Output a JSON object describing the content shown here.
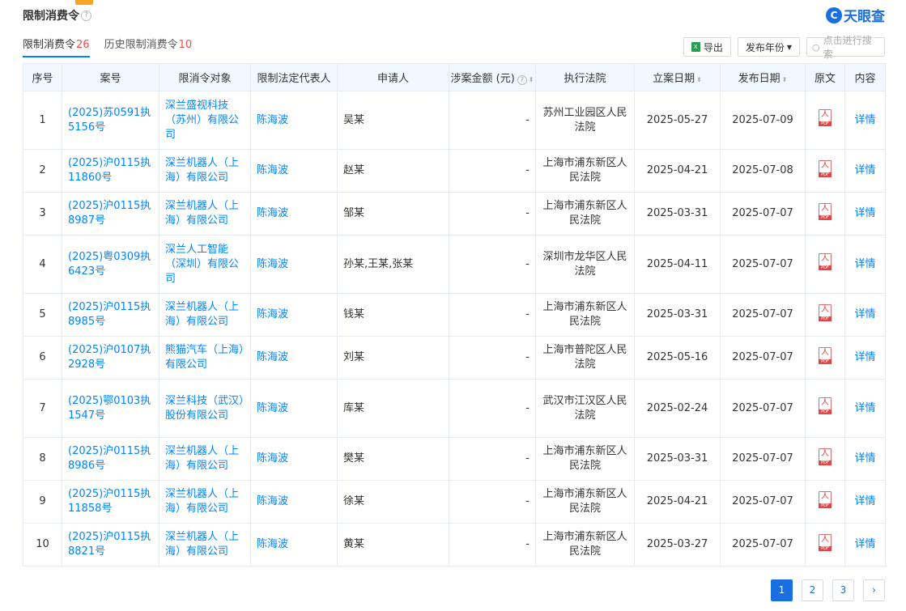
{
  "header": {
    "title": "限制消费令",
    "brand": "天眼查"
  },
  "tabs": [
    {
      "label": "限制消费令",
      "count": "26"
    },
    {
      "label": "历史限制消费令",
      "count": "10"
    }
  ],
  "toolbar": {
    "export_label": "导出",
    "year_label": "发布年份",
    "search_placeholder": "点击进行搜索"
  },
  "table": {
    "headers": [
      "序号",
      "案号",
      "限消令对象",
      "限制法定代表人",
      "申请人",
      "涉案金额 (元)",
      "执行法院",
      "立案日期",
      "发布日期",
      "原文",
      "内容"
    ],
    "rows": [
      {
        "no": "1",
        "case": "(2025)苏0591执5156号",
        "target": "深兰盛视科技（苏州）有限公司",
        "rep": "陈海波",
        "applicant": "吴某",
        "amount": "-",
        "court": "苏州工业园区人民法院",
        "filed": "2025-05-27",
        "published": "2025-07-09",
        "detail": "详情"
      },
      {
        "no": "2",
        "case": "(2025)沪0115执11860号",
        "target": "深兰机器人（上海）有限公司",
        "rep": "陈海波",
        "applicant": "赵某",
        "amount": "-",
        "court": "上海市浦东新区人民法院",
        "filed": "2025-04-21",
        "published": "2025-07-08",
        "detail": "详情"
      },
      {
        "no": "3",
        "case": "(2025)沪0115执8987号",
        "target": "深兰机器人（上海）有限公司",
        "rep": "陈海波",
        "applicant": "邹某",
        "amount": "-",
        "court": "上海市浦东新区人民法院",
        "filed": "2025-03-31",
        "published": "2025-07-07",
        "detail": "详情"
      },
      {
        "no": "4",
        "case": "(2025)粤0309执6423号",
        "target": "深兰人工智能（深圳）有限公司",
        "rep": "陈海波",
        "applicant": "孙某,王某,张某",
        "amount": "-",
        "court": "深圳市龙华区人民法院",
        "filed": "2025-04-11",
        "published": "2025-07-07",
        "detail": "详情"
      },
      {
        "no": "5",
        "case": "(2025)沪0115执8985号",
        "target": "深兰机器人（上海）有限公司",
        "rep": "陈海波",
        "applicant": "钱某",
        "amount": "-",
        "court": "上海市浦东新区人民法院",
        "filed": "2025-03-31",
        "published": "2025-07-07",
        "detail": "详情"
      },
      {
        "no": "6",
        "case": "(2025)沪0107执2928号",
        "target": "熊猫汽车（上海）有限公司",
        "rep": "陈海波",
        "applicant": "刘某",
        "amount": "-",
        "court": "上海市普陀区人民法院",
        "filed": "2025-05-16",
        "published": "2025-07-07",
        "detail": "详情"
      },
      {
        "no": "7",
        "case": "(2025)鄂0103执1547号",
        "target": "深兰科技（武汉）股份有限公司",
        "rep": "陈海波",
        "applicant": "库某",
        "amount": "-",
        "court": "武汉市江汉区人民法院",
        "filed": "2025-02-24",
        "published": "2025-07-07",
        "detail": "详情"
      },
      {
        "no": "8",
        "case": "(2025)沪0115执8986号",
        "target": "深兰机器人（上海）有限公司",
        "rep": "陈海波",
        "applicant": "樊某",
        "amount": "-",
        "court": "上海市浦东新区人民法院",
        "filed": "2025-03-31",
        "published": "2025-07-07",
        "detail": "详情"
      },
      {
        "no": "9",
        "case": "(2025)沪0115执11858号",
        "target": "深兰机器人（上海）有限公司",
        "rep": "陈海波",
        "applicant": "徐某",
        "amount": "-",
        "court": "上海市浦东新区人民法院",
        "filed": "2025-04-21",
        "published": "2025-07-07",
        "detail": "详情"
      },
      {
        "no": "10",
        "case": "(2025)沪0115执8821号",
        "target": "深兰机器人（上海）有限公司",
        "rep": "陈海波",
        "applicant": "黄某",
        "amount": "-",
        "court": "上海市浦东新区人民法院",
        "filed": "2025-03-27",
        "published": "2025-07-07",
        "detail": "详情"
      }
    ]
  },
  "pagination": {
    "pages": [
      "1",
      "2",
      "3"
    ],
    "current": "1",
    "next_icon": "chevron-right-icon"
  },
  "colors": {
    "accent": "#0084ff",
    "count": "#f04b4b",
    "header_bg": "#f2f8ff"
  }
}
